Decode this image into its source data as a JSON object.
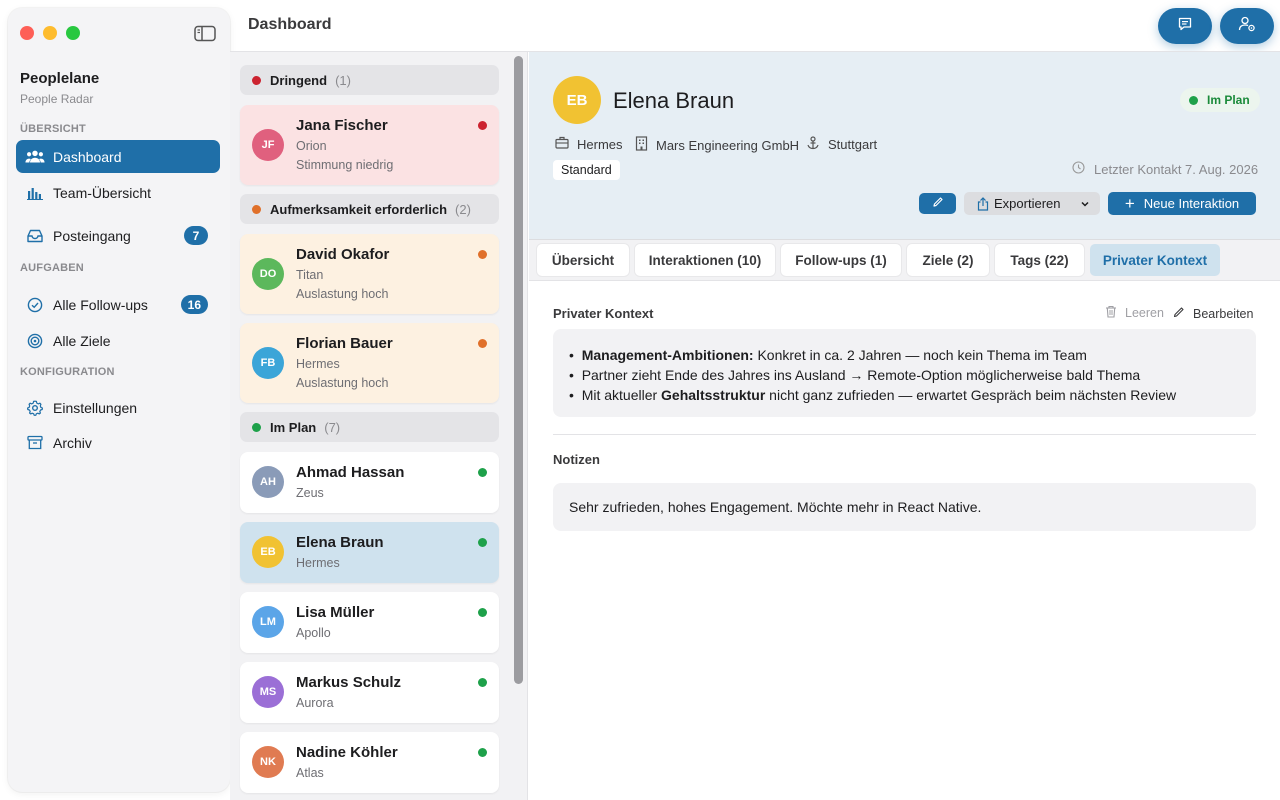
{
  "colors": {
    "accent": "#1f6fa8",
    "urgent": "#cc2330",
    "attention": "#e0702a",
    "on_track": "#1ea14a"
  },
  "sidebar": {
    "app_name": "Peoplelane",
    "app_sub": "People Radar",
    "sections": {
      "overview": "ÜBERSICHT",
      "tasks": "AUFGABEN",
      "config": "KONFIGURATION"
    },
    "items": [
      {
        "label": "Dashboard",
        "icon": "people-icon"
      },
      {
        "label": "Team-Übersicht",
        "icon": "bar-chart-icon"
      },
      {
        "label": "Posteingang",
        "icon": "inbox-icon",
        "badge": "7"
      },
      {
        "label": "Alle Follow-ups",
        "icon": "check-circle-icon",
        "badge": "16"
      },
      {
        "label": "Alle Ziele",
        "icon": "target-icon"
      },
      {
        "label": "Einstellungen",
        "icon": "gear-icon"
      },
      {
        "label": "Archiv",
        "icon": "archive-icon"
      }
    ]
  },
  "header": {
    "title": "Dashboard"
  },
  "list": {
    "groups": [
      {
        "label": "Dringend",
        "count": "(1)"
      },
      {
        "label": "Aufmerksamkeit erforderlich",
        "count": "(2)"
      },
      {
        "label": "Im Plan",
        "count": "(7)"
      }
    ],
    "people": [
      {
        "initials": "JF",
        "name": "Jana Fischer",
        "team": "Orion",
        "note": "Stimmung niedrig",
        "avatar_color": "#e0607e"
      },
      {
        "initials": "DO",
        "name": "David Okafor",
        "team": "Titan",
        "note": "Auslastung hoch",
        "avatar_color": "#5cb85c"
      },
      {
        "initials": "FB",
        "name": "Florian Bauer",
        "team": "Hermes",
        "note": "Auslastung hoch",
        "avatar_color": "#3ba5d8"
      },
      {
        "initials": "AH",
        "name": "Ahmad Hassan",
        "team": "Zeus",
        "avatar_color": "#8a9bb8"
      },
      {
        "initials": "EB",
        "name": "Elena Braun",
        "team": "Hermes",
        "avatar_color": "#f1c232"
      },
      {
        "initials": "LM",
        "name": "Lisa Müller",
        "team": "Apollo",
        "avatar_color": "#5ba5e8"
      },
      {
        "initials": "MS",
        "name": "Markus Schulz",
        "team": "Aurora",
        "avatar_color": "#9b6fd6"
      },
      {
        "initials": "NK",
        "name": "Nadine Köhler",
        "team": "Atlas",
        "avatar_color": "#e07b52"
      }
    ]
  },
  "detail": {
    "initials": "EB",
    "name": "Elena Braun",
    "status": "Im Plan",
    "team": "Hermes",
    "company": "Mars Engineering GmbH",
    "location": "Stuttgart",
    "tag": "Standard",
    "last_contact": "Letzter Kontakt 7. Aug. 2026",
    "buttons": {
      "export": "Exportieren",
      "new_interaction": "Neue Interaktion"
    },
    "tabs": [
      "Übersicht",
      "Interaktionen (10)",
      "Follow-ups (1)",
      "Ziele (2)",
      "Tags (22)",
      "Privater Kontext"
    ],
    "private_context": {
      "title": "Privater Kontext",
      "clear": "Leeren",
      "edit": "Bearbeiten",
      "bullets": [
        {
          "bold": "Management-Ambitionen:",
          "text": " Konkret in ca. 2 Jahren — noch kein Thema im Team"
        },
        {
          "pre": "Partner zieht Ende des Jahres ins Ausland → Remote-Option möglicherweise bald Thema"
        },
        {
          "pre": "Mit aktueller ",
          "bold": "Gehaltsstruktur",
          "text": " nicht ganz zufrieden — erwartet Gespräch beim nächsten Review"
        }
      ]
    },
    "notes": {
      "title": "Notizen",
      "text": "Sehr zufrieden, hohes Engagement. Möchte mehr in React Native."
    }
  }
}
